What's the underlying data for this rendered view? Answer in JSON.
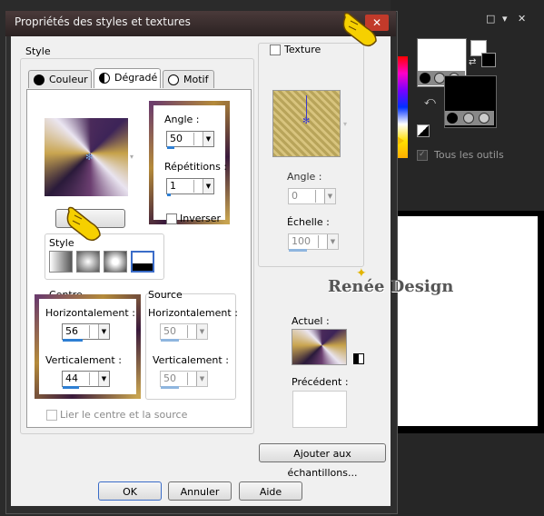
{
  "dialog": {
    "title": "Propriétés des styles et textures",
    "close_glyph": "✕",
    "style_group": "Style",
    "tabs": [
      "Couleur",
      "Dégradé",
      "Motif"
    ],
    "angle": {
      "label": "Angle :",
      "value": "50"
    },
    "repetitions": {
      "label": "Répétitions :",
      "value": "1"
    },
    "inverser": "Inverser",
    "style_label": "Style",
    "centre": {
      "title": "Centre",
      "h_label": "Horizontalement :",
      "h_value": "56",
      "v_label": "Verticalement :",
      "v_value": "44"
    },
    "source": {
      "title": "Source",
      "h_label": "Horizontalement :",
      "h_value": "50",
      "v_label": "Verticalement :",
      "v_value": "50"
    },
    "link_label": "Lier le centre et la source",
    "texture": {
      "label": "Texture",
      "angle_label": "Angle :",
      "angle_value": "0",
      "scale_label": "Échelle :",
      "scale_value": "100"
    },
    "watermark": "Renée Design",
    "actuel": "Actuel :",
    "precedent": "Précédent :",
    "add_swatch": "Ajouter aux échantillons...",
    "ok": "OK",
    "cancel": "Annuler",
    "help": "Aide"
  },
  "palette": {
    "window_controls": [
      "□",
      "▾",
      "✕"
    ],
    "all_tools": "Tous les outils",
    "foreground": "#ffffff",
    "background": "#000000"
  }
}
